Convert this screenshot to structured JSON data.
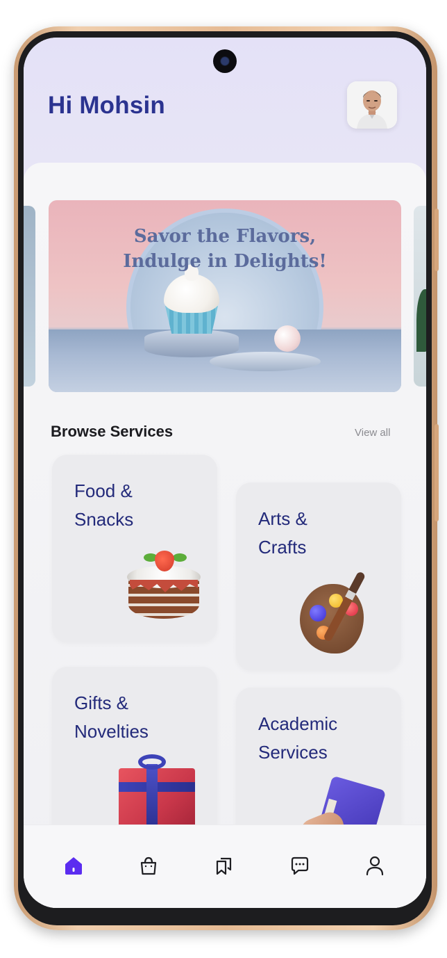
{
  "header": {
    "greeting": "Hi Mohsin"
  },
  "hero": {
    "title_line1": "Savor the Flavors,",
    "title_line2": "Indulge in Delights!"
  },
  "browse": {
    "title": "Browse Services",
    "view_all": "View all"
  },
  "services": [
    {
      "line1": "Food &",
      "line2": "Snacks",
      "icon": "cake-illustration"
    },
    {
      "line1": "Arts &",
      "line2": "Crafts",
      "icon": "paint-palette-illustration"
    },
    {
      "line1": "Gifts &",
      "line2": "Novelties",
      "icon": "gift-box-illustration"
    },
    {
      "line1": "Academic",
      "line2": "Services",
      "icon": "book-illustration"
    }
  ],
  "bottom_nav": [
    {
      "icon": "home-icon",
      "active": true
    },
    {
      "icon": "shopping-bag-icon",
      "active": false
    },
    {
      "icon": "bookmarks-icon",
      "active": false
    },
    {
      "icon": "chat-icon",
      "active": false
    },
    {
      "icon": "profile-icon",
      "active": false
    }
  ],
  "colors": {
    "accent": "#5b2cf0",
    "heading": "#2b3390",
    "card_text": "#232a7a",
    "header_bg": "#e4e1f7"
  }
}
